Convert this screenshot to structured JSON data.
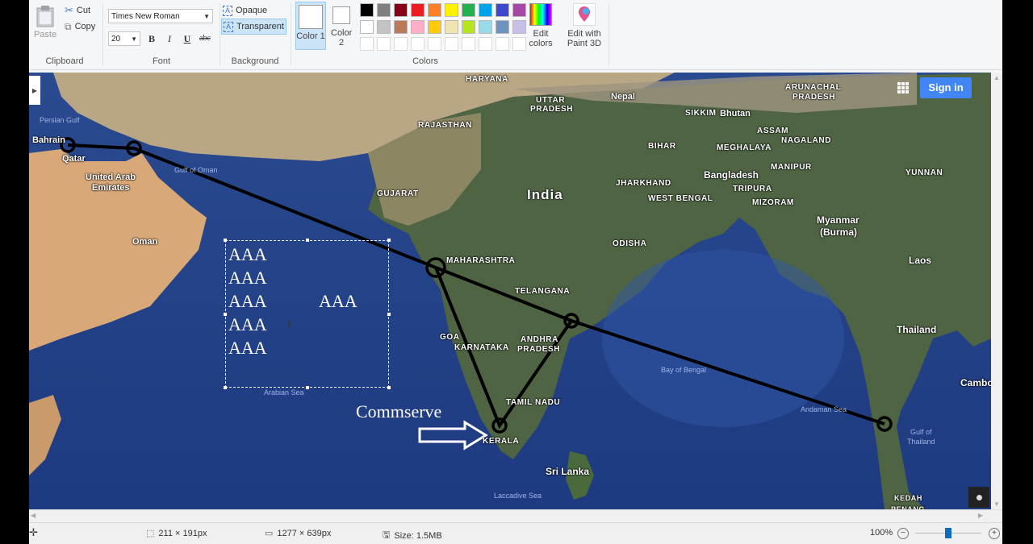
{
  "ribbon": {
    "clipboard": {
      "label": "Clipboard",
      "paste": "Paste",
      "cut": "Cut",
      "copy": "Copy"
    },
    "font": {
      "label": "Font",
      "family": "Times New Roman",
      "size": "20",
      "bold": "B",
      "italic": "I",
      "underline": "U",
      "strikethrough": "abc"
    },
    "background": {
      "label": "Background",
      "opaque": "Opaque",
      "transparent": "Transparent",
      "selected": "Transparent"
    },
    "colors": {
      "label": "Colors",
      "color1": "Color 1",
      "color2": "Color 2",
      "color1_value": "#ffffff",
      "color2_value": "#ffffff",
      "edit_colors": "Edit colors",
      "edit_paint3d": "Edit with Paint 3D",
      "palette_row1": [
        "#000000",
        "#7f7f7f",
        "#880015",
        "#ed1c24",
        "#ff7f27",
        "#fff200",
        "#22b14c",
        "#00a2e8",
        "#3f48cc",
        "#a349a4"
      ],
      "palette_row2": [
        "#ffffff",
        "#c3c3c3",
        "#b97a57",
        "#ffaec9",
        "#ffc90e",
        "#efe4b0",
        "#b5e61d",
        "#99d9ea",
        "#7092be",
        "#c8bfe7"
      ],
      "palette_row3_count": 10
    }
  },
  "map": {
    "sign_in": "Sign in",
    "labels": {
      "haryana": "HARYANA",
      "uttar_pradesh_1": "UTTAR",
      "uttar_pradesh_2": "PRADESH",
      "nepal": "Nepal",
      "rajasthan": "RAJASTHAN",
      "arunachal_1": "ARUNACHAL",
      "arunachal_2": "PRADESH",
      "sikkim": "SIKKIM",
      "bhutan": "Bhutan",
      "assam": "ASSAM",
      "nagaland": "NAGALAND",
      "bihar": "BIHAR",
      "meghalaya": "MEGHALAYA",
      "manipur": "MANIPUR",
      "bangladesh": "Bangladesh",
      "yunnan": "YUNNAN",
      "jharkhand": "JHARKHAND",
      "tripura": "TRIPURA",
      "gujarat": "GUJARAT",
      "india": "India",
      "west_bengal": "WEST BENGAL",
      "mizoram": "MIZORAM",
      "myanmar_1": "Myanmar",
      "myanmar_2": "(Burma)",
      "odisha": "ODISHA",
      "maharashtra": "MAHARASHTRA",
      "laos": "Laos",
      "telangana": "TELANGANA",
      "goa": "GOA",
      "karnataka": "KARNATAKA",
      "andhra_1": "ANDHRA",
      "andhra_2": "PRADESH",
      "thailand": "Thailand",
      "bay_of_bengal": "Bay of Bengal",
      "cambodia": "Cambo",
      "tamil_nadu": "TAMIL NADU",
      "andaman_sea": "Andaman Sea",
      "gulf_thailand_1": "Gulf of",
      "gulf_thailand_2": "Thailand",
      "kerala": "KERALA",
      "sri_lanka": "Sri Lanka",
      "laccadive_sea": "Laccadive Sea",
      "kedah": "KEDAH",
      "penang": "PENANG",
      "persian_gulf": "Persian Gulf",
      "bahrain": "Bahrain",
      "qatar": "Qatar",
      "uae_1": "United Arab",
      "uae_2": "Emirates",
      "gulf_of_oman": "Gulf of Oman",
      "oman": "Oman",
      "arabian_sea": "Arabian Sea"
    },
    "text_box_lines": [
      "AAA",
      "AAA",
      "AAA",
      "AAA",
      "AAA"
    ],
    "text_box_extra": "AAA",
    "annotation": "Commserve"
  },
  "status": {
    "selection_size": "211 × 191px",
    "image_size": "1277 × 639px",
    "file_size": "Size: 1.5MB",
    "zoom": "100%",
    "zoom_level_percent": 100
  }
}
